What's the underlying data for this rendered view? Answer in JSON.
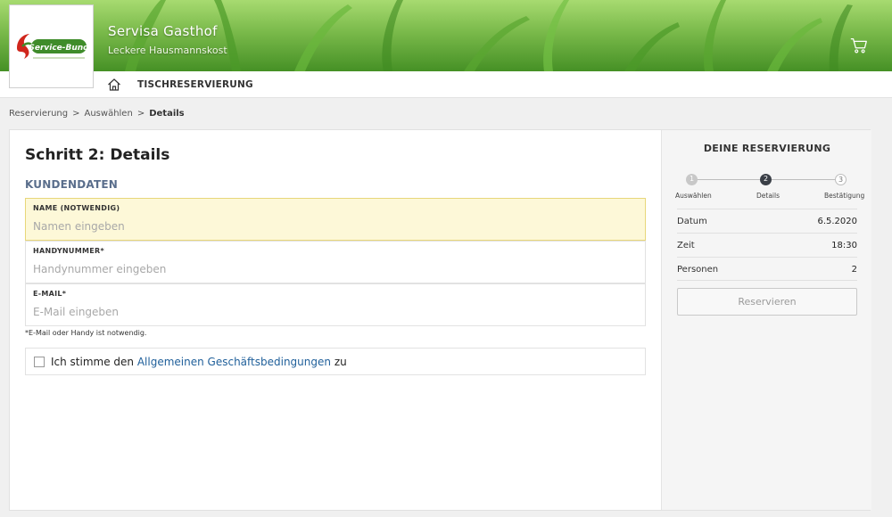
{
  "brand": {
    "name": "Servisa Gasthof",
    "tagline": "Leckere Hausmannskost",
    "logo_text": "Service-Bund"
  },
  "nav": {
    "label": "TISCHRESERVIERUNG"
  },
  "breadcrumb": {
    "items": [
      "Reservierung",
      "Auswählen",
      "Details"
    ],
    "separator": ">"
  },
  "form": {
    "title": "Schritt 2: Details",
    "section": "KUNDENDATEN",
    "fields": [
      {
        "label": "NAME (NOTWENDIG)",
        "placeholder": "Namen eingeben",
        "value": ""
      },
      {
        "label": "HANDYNUMMER*",
        "placeholder": "Handynummer eingeben",
        "value": ""
      },
      {
        "label": "E-MAIL*",
        "placeholder": "E-Mail eingeben",
        "value": ""
      }
    ],
    "note": "*E-Mail oder Handy ist notwendig.",
    "agree": {
      "prefix": "Ich stimme den ",
      "link": "Allgemeinen Geschäftsbedingungen",
      "suffix": " zu",
      "checked": false
    }
  },
  "reservation": {
    "title": "DEINE RESERVIERUNG",
    "steps": [
      {
        "num": "1",
        "label": "Auswählen",
        "state": "done"
      },
      {
        "num": "2",
        "label": "Details",
        "state": "current"
      },
      {
        "num": "3",
        "label": "Bestätigung",
        "state": "todo"
      }
    ],
    "rows": [
      {
        "key": "Datum",
        "value": "6.5.2020"
      },
      {
        "key": "Zeit",
        "value": "18:30"
      },
      {
        "key": "Personen",
        "value": "2"
      }
    ],
    "button_label": "Reservieren"
  },
  "colors": {
    "accent_link": "#1f5f9a",
    "section_title": "#5a6e8c",
    "active_field_bg": "#fdf8d8",
    "logo_red": "#d0261c",
    "logo_green": "#3f8c2a"
  },
  "icons": {
    "home": "home-icon",
    "cart": "cart-icon"
  }
}
